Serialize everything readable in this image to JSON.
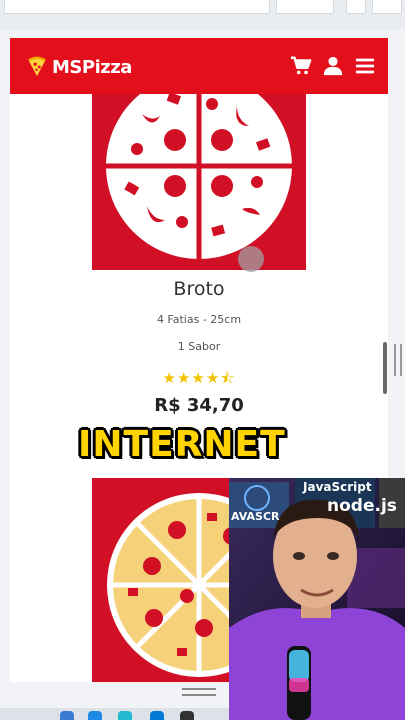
{
  "navbar": {
    "brand": "MSPizza",
    "icons": [
      "cart-icon",
      "user-icon",
      "menu-icon"
    ]
  },
  "product": {
    "name": "Broto",
    "slices": "4 Fatias - 25cm",
    "flavors": "1 Sabor",
    "rating": 4.5,
    "stars": "★★★★⯪",
    "price": "R$ 34,70"
  },
  "caption": "INTERNET",
  "webcam": {
    "tags": [
      "JavaScript",
      "node.js",
      "AVASCR"
    ]
  },
  "colors": {
    "brand_red": "#e3101c",
    "image_red": "#d10f25",
    "star_yellow": "#f2c200",
    "caption_yellow": "#ffd400"
  }
}
